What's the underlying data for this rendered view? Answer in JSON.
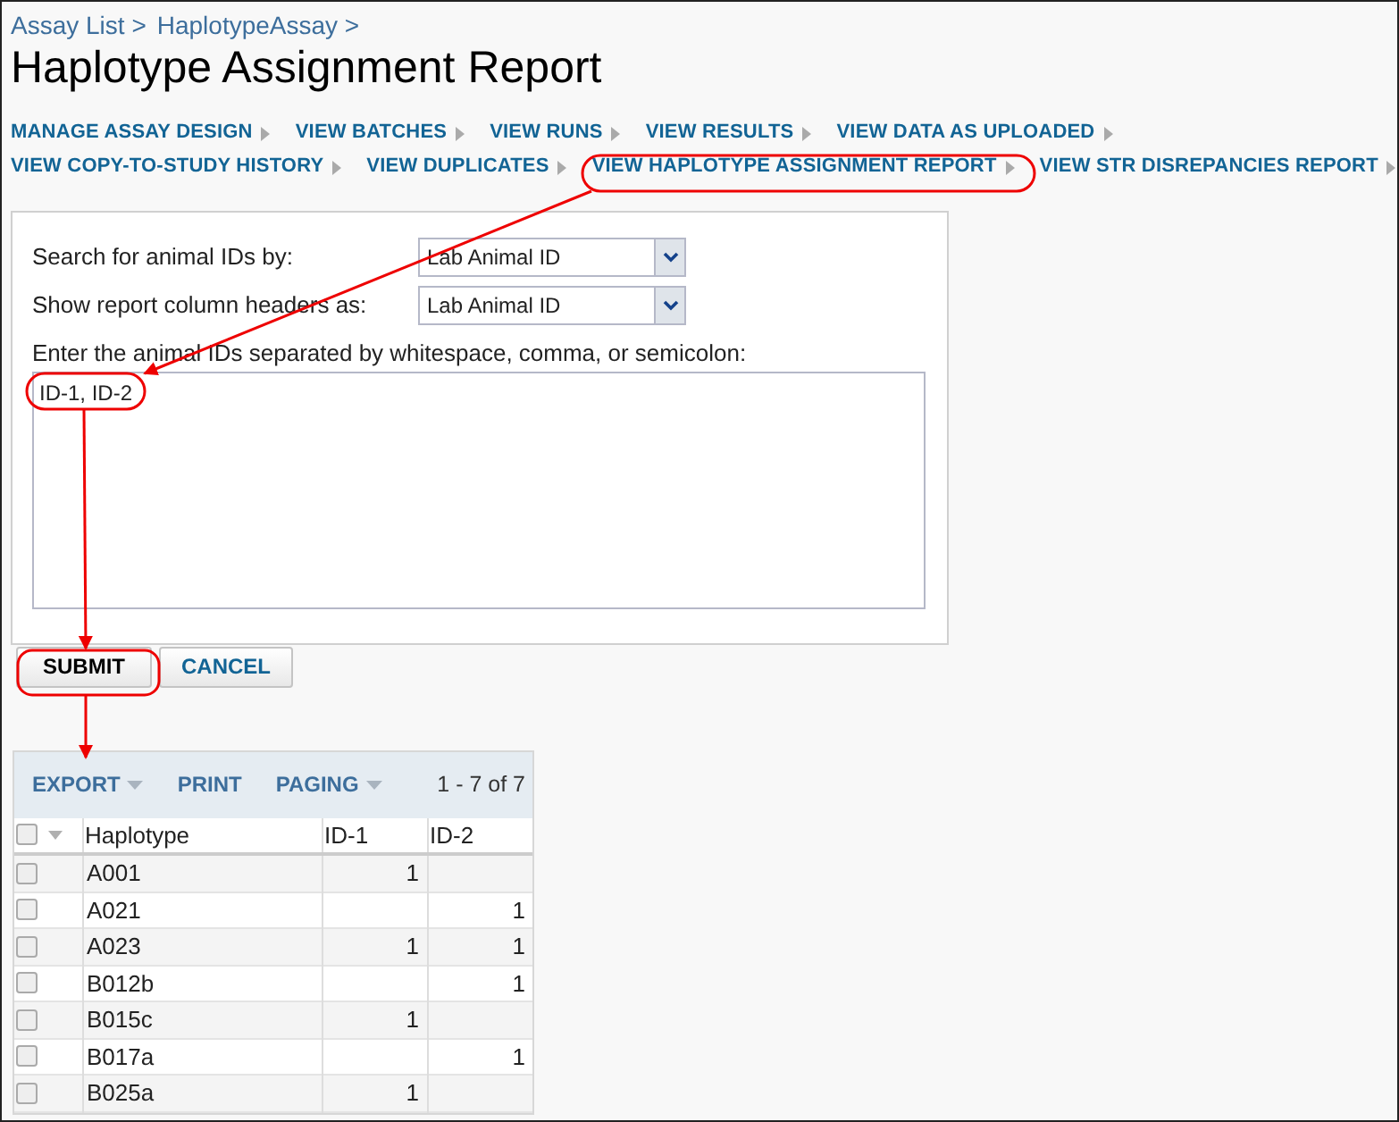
{
  "breadcrumb": [
    "Assay List >",
    "HaplotypeAssay >"
  ],
  "title": "Haplotype Assignment Report",
  "nav_rows": [
    [
      {
        "label": "MANAGE ASSAY DESIGN"
      },
      {
        "label": "VIEW BATCHES"
      },
      {
        "label": "VIEW RUNS"
      },
      {
        "label": "VIEW RESULTS"
      },
      {
        "label": "VIEW DATA AS UPLOADED"
      }
    ],
    [
      {
        "label": "VIEW COPY-TO-STUDY HISTORY"
      },
      {
        "label": "VIEW DUPLICATES"
      },
      {
        "label": "VIEW HAPLOTYPE ASSIGNMENT REPORT"
      },
      {
        "label": "VIEW STR DISREPANCIES REPORT"
      }
    ]
  ],
  "form": {
    "search_by": {
      "label": "Search for animal IDs by:",
      "value": "Lab Animal ID"
    },
    "headers_as": {
      "label": "Show report column headers as:",
      "value": "Lab Animal ID"
    },
    "ids": {
      "label": "Enter the animal IDs separated by whitespace, comma, or semicolon:",
      "value": "ID-1, ID-2"
    }
  },
  "buttons": [
    {
      "label": "SUBMIT",
      "kind": "primary"
    },
    {
      "label": "CANCEL",
      "kind": "secondary"
    }
  ],
  "grid": {
    "toolbar": [
      {
        "label": "EXPORT",
        "menu": true
      },
      {
        "label": "PRINT",
        "menu": false
      },
      {
        "label": "PAGING",
        "menu": true
      }
    ],
    "count": "1 - 7 of 7",
    "select_all_checked": false,
    "columns": [
      "Haplotype",
      "ID-1",
      "ID-2"
    ],
    "rows": [
      {
        "checked": false,
        "cells": [
          "A001",
          "1",
          ""
        ]
      },
      {
        "checked": false,
        "cells": [
          "A021",
          "",
          "1"
        ]
      },
      {
        "checked": false,
        "cells": [
          "A023",
          "1",
          "1"
        ]
      },
      {
        "checked": false,
        "cells": [
          "B012b",
          "",
          "1"
        ]
      },
      {
        "checked": false,
        "cells": [
          "B015c",
          "1",
          ""
        ]
      },
      {
        "checked": false,
        "cells": [
          "B017a",
          "",
          "1"
        ]
      },
      {
        "checked": false,
        "cells": [
          "B025a",
          "1",
          ""
        ]
      }
    ]
  }
}
